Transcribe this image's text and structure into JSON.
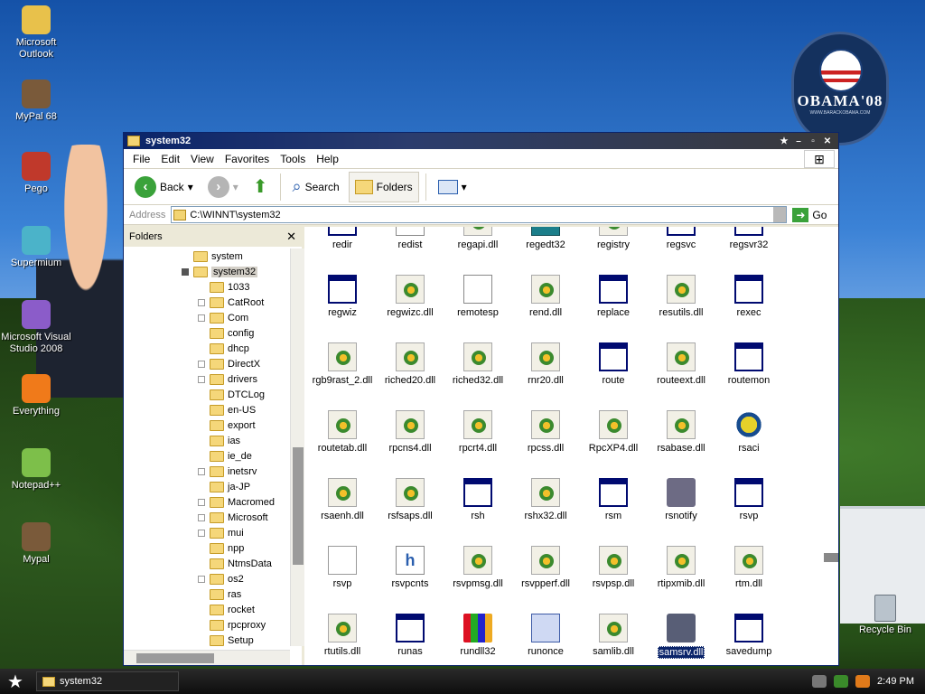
{
  "desktop": {
    "icons": [
      {
        "label": "Microsoft Outlook",
        "color": "#e8c14b"
      },
      {
        "label": "MyPal 68",
        "color": "#7a5a3a"
      },
      {
        "label": "Pego",
        "color": "#c0392b"
      },
      {
        "label": "Supermium",
        "color": "#4bb3c9"
      },
      {
        "label": "Microsoft Visual Studio 2008",
        "color": "#8b5cc9"
      },
      {
        "label": "Everything",
        "color": "#f07a1a"
      },
      {
        "label": "Notepad++",
        "color": "#7dbf4a"
      },
      {
        "label": "Mypal",
        "color": "#7a5a3a"
      }
    ],
    "recycle_bin": "Recycle Bin",
    "logo_text": "OBAMA'08",
    "logo_sub": "WWW.BARACKOBAMA.COM"
  },
  "window": {
    "title": "system32",
    "title_buttons": {
      "pin": "★",
      "minimize": "–",
      "maximize": "▫",
      "close": "✕"
    },
    "menu": [
      "File",
      "Edit",
      "View",
      "Favorites",
      "Tools",
      "Help"
    ],
    "toolbar": {
      "back": "Back",
      "search": "Search",
      "folders": "Folders"
    },
    "address": {
      "label": "Address",
      "value": "C:\\WINNT\\system32",
      "go": "Go"
    },
    "folders_pane": {
      "title": "Folders",
      "close": "✕",
      "items": [
        {
          "label": "system",
          "level": 0,
          "box": "none"
        },
        {
          "label": "system32",
          "level": 0,
          "box": "dark",
          "selected": true
        },
        {
          "label": "1033",
          "level": 1,
          "box": "none"
        },
        {
          "label": "CatRoot",
          "level": 1,
          "box": "plus"
        },
        {
          "label": "Com",
          "level": 1,
          "box": "plus"
        },
        {
          "label": "config",
          "level": 1,
          "box": "none"
        },
        {
          "label": "dhcp",
          "level": 1,
          "box": "none"
        },
        {
          "label": "DirectX",
          "level": 1,
          "box": "plus"
        },
        {
          "label": "drivers",
          "level": 1,
          "box": "plus"
        },
        {
          "label": "DTCLog",
          "level": 1,
          "box": "none"
        },
        {
          "label": "en-US",
          "level": 1,
          "box": "none"
        },
        {
          "label": "export",
          "level": 1,
          "box": "none"
        },
        {
          "label": "ias",
          "level": 1,
          "box": "none"
        },
        {
          "label": "ie_de",
          "level": 1,
          "box": "none"
        },
        {
          "label": "inetsrv",
          "level": 1,
          "box": "plus"
        },
        {
          "label": "ja-JP",
          "level": 1,
          "box": "none"
        },
        {
          "label": "Macromed",
          "level": 1,
          "box": "plus"
        },
        {
          "label": "Microsoft",
          "level": 1,
          "box": "plus"
        },
        {
          "label": "mui",
          "level": 1,
          "box": "plus"
        },
        {
          "label": "npp",
          "level": 1,
          "box": "none"
        },
        {
          "label": "NtmsData",
          "level": 1,
          "box": "none"
        },
        {
          "label": "os2",
          "level": 1,
          "box": "plus"
        },
        {
          "label": "ras",
          "level": 1,
          "box": "none"
        },
        {
          "label": "rocket",
          "level": 1,
          "box": "none"
        },
        {
          "label": "rpcproxy",
          "level": 1,
          "box": "none"
        },
        {
          "label": "Setup",
          "level": 1,
          "box": "none"
        }
      ]
    },
    "files": [
      {
        "label": "redir",
        "type": "exe"
      },
      {
        "label": "redist",
        "type": "cfg"
      },
      {
        "label": "regapi.dll",
        "type": "dll"
      },
      {
        "label": "regedt32",
        "type": "reg"
      },
      {
        "label": "registry",
        "type": "dll"
      },
      {
        "label": "regsvc",
        "type": "exe"
      },
      {
        "label": "regsvr32",
        "type": "exe"
      },
      {
        "label": "regwiz",
        "type": "exe"
      },
      {
        "label": "regwizc.dll",
        "type": "dll"
      },
      {
        "label": "remotesp",
        "type": "cfg"
      },
      {
        "label": "rend.dll",
        "type": "dll"
      },
      {
        "label": "replace",
        "type": "exe"
      },
      {
        "label": "resutils.dll",
        "type": "dll"
      },
      {
        "label": "rexec",
        "type": "exe"
      },
      {
        "label": "rgb9rast_2.dll",
        "type": "dll"
      },
      {
        "label": "riched20.dll",
        "type": "dll"
      },
      {
        "label": "riched32.dll",
        "type": "dll"
      },
      {
        "label": "rnr20.dll",
        "type": "dll"
      },
      {
        "label": "route",
        "type": "exe"
      },
      {
        "label": "routeext.dll",
        "type": "dll"
      },
      {
        "label": "routemon",
        "type": "exe"
      },
      {
        "label": "routetab.dll",
        "type": "dll"
      },
      {
        "label": "rpcns4.dll",
        "type": "dll"
      },
      {
        "label": "rpcrt4.dll",
        "type": "dll"
      },
      {
        "label": "rpcss.dll",
        "type": "dll"
      },
      {
        "label": "RpcXP4.dll",
        "type": "dll"
      },
      {
        "label": "rsabase.dll",
        "type": "dll"
      },
      {
        "label": "rsaci",
        "type": "ico"
      },
      {
        "label": "rsaenh.dll",
        "type": "dll"
      },
      {
        "label": "rsfsaps.dll",
        "type": "dll"
      },
      {
        "label": "rsh",
        "type": "exe"
      },
      {
        "label": "rshx32.dll",
        "type": "dll"
      },
      {
        "label": "rsm",
        "type": "exe"
      },
      {
        "label": "rsnotify",
        "type": "srv"
      },
      {
        "label": "rsvp",
        "type": "exe"
      },
      {
        "label": "rsvp",
        "type": "notes"
      },
      {
        "label": "rsvpcnts",
        "type": "h"
      },
      {
        "label": "rsvpmsg.dll",
        "type": "dll"
      },
      {
        "label": "rsvpperf.dll",
        "type": "dll"
      },
      {
        "label": "rsvpsp.dll",
        "type": "dll"
      },
      {
        "label": "rtipxmib.dll",
        "type": "dll"
      },
      {
        "label": "rtm.dll",
        "type": "dll"
      },
      {
        "label": "rtutils.dll",
        "type": "dll"
      },
      {
        "label": "runas",
        "type": "exe"
      },
      {
        "label": "rundll32",
        "type": "wg"
      },
      {
        "label": "runonce",
        "type": "prog"
      },
      {
        "label": "samlib.dll",
        "type": "dll"
      },
      {
        "label": "samsrv.dll",
        "type": "srv",
        "selected": true
      },
      {
        "label": "savedump",
        "type": "exe"
      }
    ]
  },
  "taskbar": {
    "start": "★",
    "task_label": "system32",
    "clock": "2:49 PM"
  }
}
